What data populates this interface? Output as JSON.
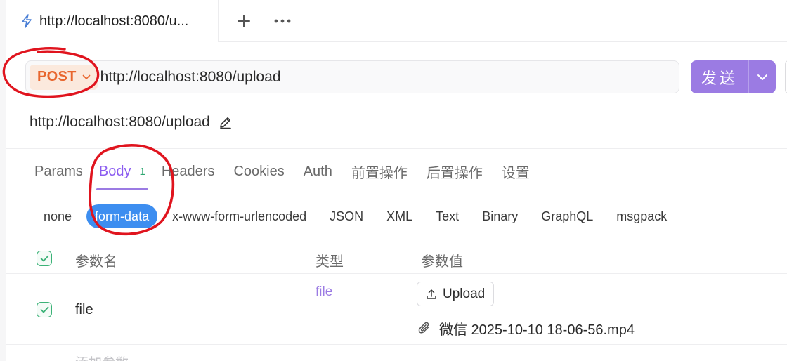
{
  "tab": {
    "title": "http://localhost:8080/u..."
  },
  "request": {
    "method": "POST",
    "url": "http://localhost:8080/upload",
    "name": "http://localhost:8080/upload",
    "send_label": "发送"
  },
  "request_tabs": [
    {
      "label": "Params"
    },
    {
      "label": "Body",
      "count": "1",
      "active": true
    },
    {
      "label": "Headers"
    },
    {
      "label": "Cookies"
    },
    {
      "label": "Auth"
    },
    {
      "label": "前置操作"
    },
    {
      "label": "后置操作"
    },
    {
      "label": "设置"
    }
  ],
  "body_types": [
    {
      "label": "none"
    },
    {
      "label": "form-data",
      "active": true
    },
    {
      "label": "x-www-form-urlencoded"
    },
    {
      "label": "JSON"
    },
    {
      "label": "XML"
    },
    {
      "label": "Text"
    },
    {
      "label": "Binary"
    },
    {
      "label": "GraphQL"
    },
    {
      "label": "msgpack"
    }
  ],
  "table": {
    "headers": {
      "name": "参数名",
      "type": "类型",
      "value": "参数值"
    },
    "rows": [
      {
        "name": "file",
        "type": "file",
        "upload_label": "Upload",
        "file_name": "微信 2025-10-10 18-06-56.mp4"
      }
    ],
    "add_placeholder": "添加参数"
  },
  "colors": {
    "accent": "#9b7be3",
    "method": "#e8662e",
    "active_type": "#3d8ef0",
    "check": "#3bb277",
    "annotation": "#e0141e"
  }
}
